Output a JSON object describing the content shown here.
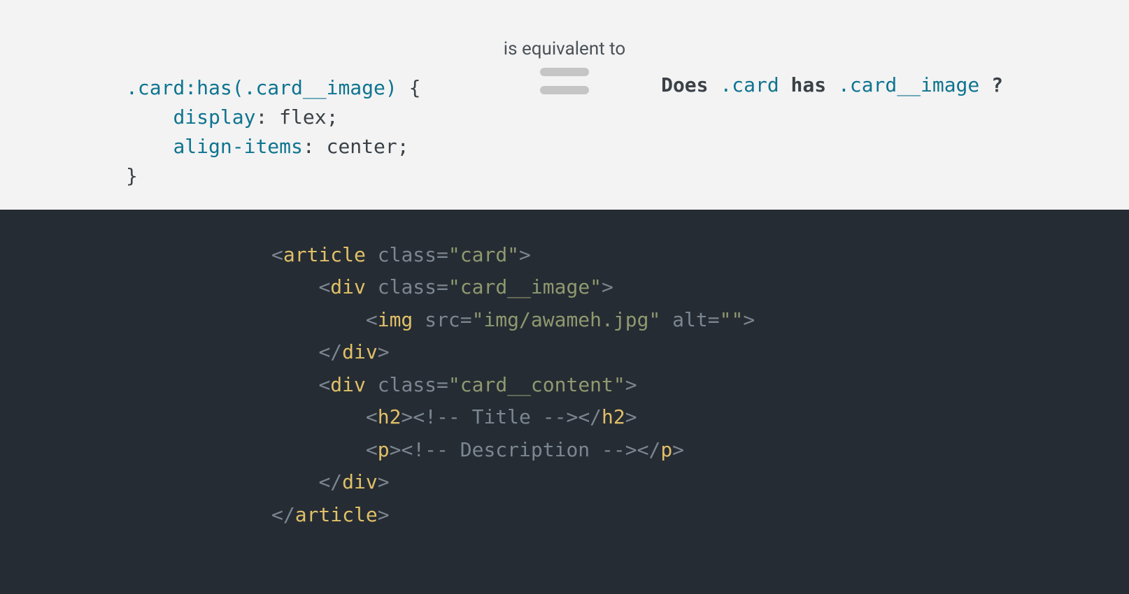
{
  "equiv_label": "is equivalent to",
  "css": {
    "selector_class": ".card",
    "pseudo_open": ":has(",
    "pseudo_arg": ".card__image",
    "pseudo_close": ")",
    "rules": [
      {
        "prop": "display",
        "val": "flex"
      },
      {
        "prop": "align-items",
        "val": "center"
      }
    ]
  },
  "question": {
    "does": "Does ",
    "card": ".card",
    "has": " has ",
    "image": ".card__image",
    "qmark": " ?"
  },
  "html": {
    "indent1": "    ",
    "indent2": "        ",
    "article_open": "article",
    "class_attr": "class",
    "card_val": "\"card\"",
    "div": "div",
    "card_image_val": "\"card__image\"",
    "img": "img",
    "src_attr": "src",
    "src_val": "\"img/awameh.jpg\"",
    "alt_attr": "alt",
    "alt_val": "\"\"",
    "card_content_val": "\"card__content\"",
    "h2": "h2",
    "title_comment": "<!-- Title -->",
    "p": "p",
    "desc_comment": "<!-- Description -->"
  }
}
